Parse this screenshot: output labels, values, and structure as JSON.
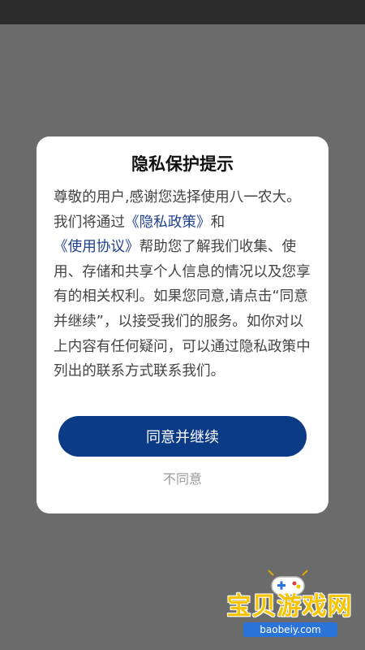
{
  "dialog": {
    "title": "隐私保护提示",
    "body": {
      "part1": "尊敬的用户,感谢您选择使用八一农大。我们将通过",
      "privacy_link": "《隐私政策》",
      "part2": "和",
      "terms_link": "《使用协议》",
      "part3": "帮助您了解我们收集、使用、存储和共享个人信息的情况以及您享有的相关权利。如果您同意,请点击“同意并继续”，以接受我们的服务。如你对以上内容有任何疑问，可以通过隐私政策中列出的联系方式联系我们。"
    },
    "agree_label": "同意并继续",
    "disagree_label": "不同意"
  },
  "watermark": {
    "brand": "宝贝游戏网",
    "url": "baobeiy.com",
    "icon": "gamepad-icon"
  },
  "colors": {
    "overlay": "#6b6b6b",
    "status_bar": "#2b2b2b",
    "primary": "#0b3a86",
    "link": "#1f3f8f",
    "watermark_yellow": "#f5c400",
    "watermark_blue": "#2a73d8"
  }
}
